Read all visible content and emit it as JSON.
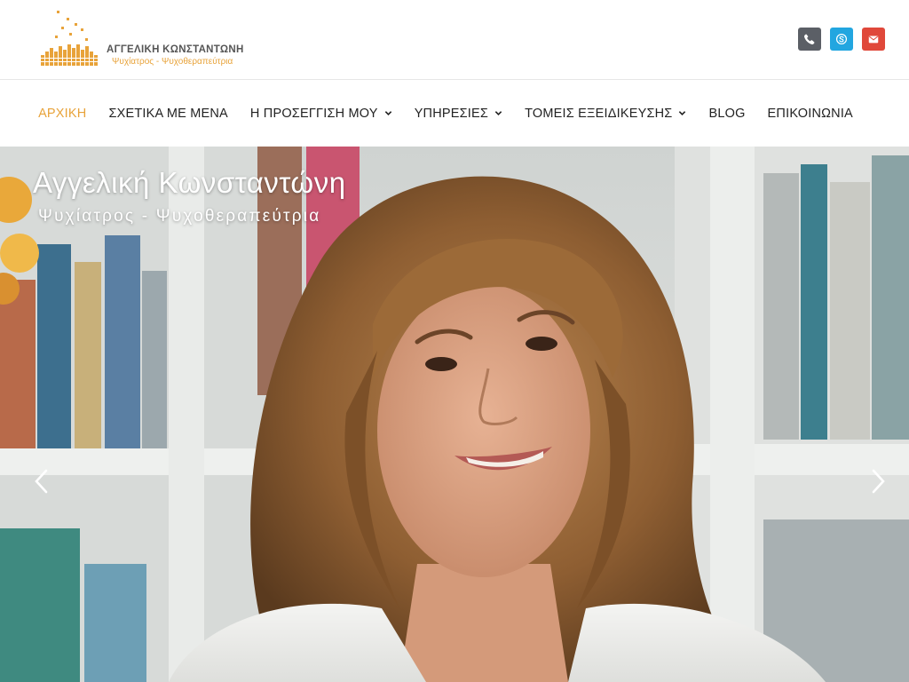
{
  "header": {
    "logo": {
      "name": "ΑΓΓΕΛΙΚΗ ΚΩΝΣΤΑΝΤΩΝΗ",
      "subtitle": "Ψυχίατρος - Ψυχοθεραπεύτρια"
    },
    "contact_icons": [
      {
        "icon": "phone-icon",
        "color": "#5b5f66"
      },
      {
        "icon": "skype-icon",
        "color": "#22a6e0"
      },
      {
        "icon": "email-icon",
        "color": "#e0483a"
      }
    ]
  },
  "nav": {
    "items": [
      {
        "label": "ΑΡΧΙΚΗ",
        "active": true,
        "has_dropdown": false
      },
      {
        "label": "ΣΧΕΤΙΚΑ ΜΕ ΜΕΝΑ",
        "active": false,
        "has_dropdown": false
      },
      {
        "label": "Η ΠΡΟΣΕΓΓΙΣΗ ΜΟΥ",
        "active": false,
        "has_dropdown": true
      },
      {
        "label": "ΥΠΗΡΕΣΙΕΣ",
        "active": false,
        "has_dropdown": true
      },
      {
        "label": "ΤΟΜΕΙΣ ΕΞΕΙΔΙΚΕΥΣΗΣ",
        "active": false,
        "has_dropdown": true
      },
      {
        "label": "BLOG",
        "active": false,
        "has_dropdown": false
      },
      {
        "label": "ΕΠΙΚΟΙΝΩΝΙΑ",
        "active": false,
        "has_dropdown": false
      }
    ]
  },
  "hero": {
    "title": "Αγγελική Κωνσταντώνη",
    "subtitle": "Ψυχίατρος - Ψυχοθεραπεύτρια",
    "prev_icon": "chevron-left-icon",
    "next_icon": "chevron-right-icon"
  },
  "colors": {
    "accent": "#e8a33a",
    "nav_text": "#222222"
  }
}
